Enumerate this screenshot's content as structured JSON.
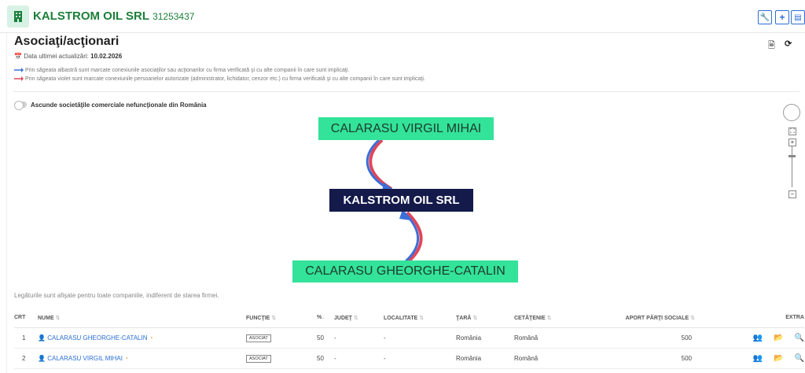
{
  "company": {
    "name": "KALSTROM OIL SRL",
    "id": "31253437"
  },
  "section": {
    "title": "Asociaţi/acţionari",
    "updated_label": "Data ultimei actualizări:",
    "updated_date": "10.02.2026",
    "legend_blue": "Prin săgeata albastră sunt marcate conexiunile asociaţilor sau acţionarilor cu firma verificată şi cu alte companii în care sunt implicaţi.",
    "legend_violet": "Prin săgeata violet sunt marcate conexiunile persoanelor autorizate (administrator, lichidator, cenzor etc.) cu firma verificată şi cu alte companii în care sunt implicaţi.",
    "toggle_label": "Ascunde societăţile comerciale nefuncţionale din România",
    "note": "Legăturile sunt afişate pentru toate companiile, indiferent de starea firmei."
  },
  "graph": {
    "node_top": "CALARASU VIRGIL MIHAI",
    "node_center": "KALSTROM OIL SRL",
    "node_bottom": "CALARASU GHEORGHE-CATALIN"
  },
  "table": {
    "headers": {
      "crt": "CRT",
      "nume": "NUME",
      "functie": "FUNCŢIE",
      "pct": "%",
      "judet": "JUDEŢ",
      "localitate": "LOCALITATE",
      "tara": "ŢARĂ",
      "cetatenie": "CETĂŢENIE",
      "aport": "APORT PĂRŢI SOCIALE",
      "extra": "EXTRA"
    },
    "rows": [
      {
        "crt": "1",
        "nume": "CALARASU GHEORGHE-CATALIN",
        "functie": "ASOCIAT",
        "pct": "50",
        "judet": "-",
        "localitate": "-",
        "tara": "România",
        "cetatenie": "Română",
        "aport": "500"
      },
      {
        "crt": "2",
        "nume": "CALARASU VIRGIL MIHAI",
        "functie": "ASOCIAT",
        "pct": "50",
        "judet": "-",
        "localitate": "-",
        "tara": "România",
        "cetatenie": "Română",
        "aport": "500"
      }
    ]
  },
  "colors": {
    "accent": "#1b7f3a",
    "link": "#2a6fd6",
    "node_green": "#33e39a",
    "node_dark": "#141a4a",
    "arrow_blue": "#3b6fd8",
    "arrow_red": "#e0465a"
  },
  "icons": [
    "building-icon",
    "wrench-icon",
    "plus-icon",
    "document-icon",
    "calendar-icon",
    "pdf-icon",
    "refresh-icon",
    "user-icon",
    "share-icon",
    "users-icon",
    "folder-icon",
    "search-icon"
  ]
}
